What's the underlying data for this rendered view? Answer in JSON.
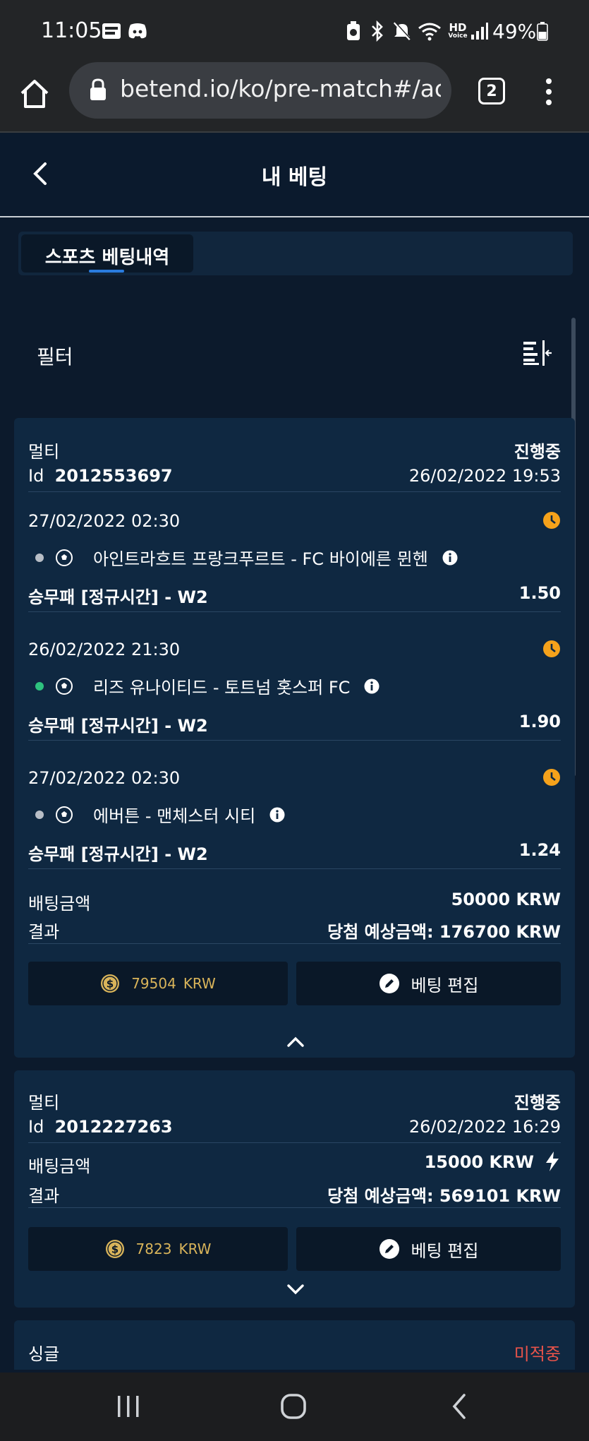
{
  "status_bar": {
    "time": "11:05",
    "battery": "49%",
    "hd_voice_top": "HD",
    "hd_voice_bottom": "Voice"
  },
  "browser": {
    "url": "betend.io/ko/pre-match#/ac",
    "tab_count": "2"
  },
  "header": {
    "title": "내 베팅"
  },
  "tabs": [
    {
      "label": "스포츠 베팅내역"
    }
  ],
  "filter": {
    "label": "필터"
  },
  "bets": [
    {
      "type": "멀티",
      "status": "진행중",
      "id_label": "Id",
      "id": "2012553697",
      "placed_at": "26/02/2022 19:53",
      "selections": [
        {
          "datetime": "27/02/2022 02:30",
          "match": "아인트라흐트 프랑크푸르트 - FC 바이에른 뮌헨",
          "market": "승무패 [정규시간] - W2",
          "odds": "1.50"
        },
        {
          "datetime": "26/02/2022 21:30",
          "match": "리즈 유나이티드 - 토트넘 홋스퍼 FC",
          "market": "승무패 [정규시간] - W2",
          "odds": "1.90"
        },
        {
          "datetime": "27/02/2022 02:30",
          "match": "에버튼 - 맨체스터 시티",
          "market": "승무패 [정규시간] - W2",
          "odds": "1.24"
        }
      ],
      "stake_label": "배팅금액",
      "stake": "50000 KRW",
      "result_label": "결과",
      "potential": "당첨 예상금액: 176700 KRW",
      "cashout_value": "79504",
      "cashout_currency": "KRW",
      "edit_label": "베팅 편집"
    },
    {
      "type": "멀티",
      "status": "진행중",
      "id_label": "Id",
      "id": "2012227263",
      "placed_at": "26/02/2022 16:29",
      "stake_label": "배팅금액",
      "stake": "15000 KRW",
      "result_label": "결과",
      "potential": "당첨 예상금액: 569101 KRW",
      "cashout_value": "7823",
      "cashout_currency": "KRW",
      "edit_label": "베팅 편집"
    },
    {
      "type": "싱글",
      "status": "미적중"
    }
  ],
  "colors": {
    "background": "#0c1a2c",
    "card": "#0f2841",
    "accent_blue": "#2a7cdf",
    "clock_orange": "#f5a21b",
    "coin_gold": "#d9b45a",
    "lost_red": "#e8534a",
    "live_green": "#2ec27e",
    "dot_grey": "#b8bec6"
  }
}
